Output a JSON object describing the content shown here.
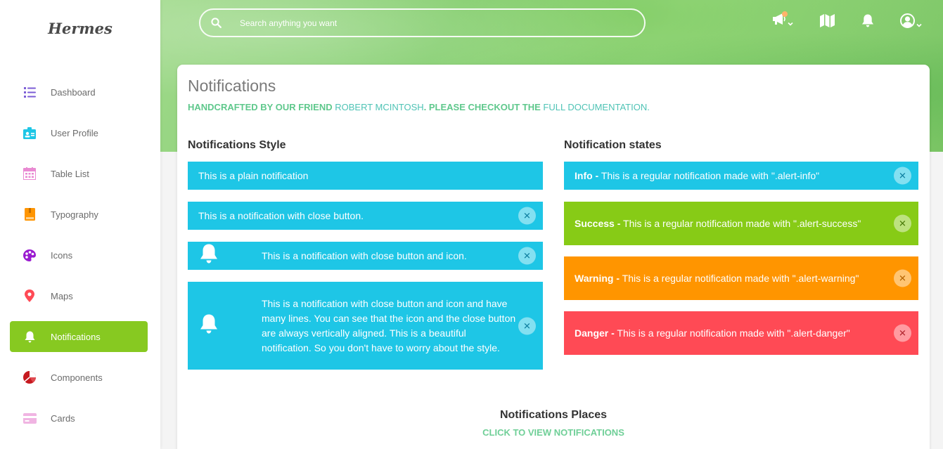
{
  "sidebar": {
    "brand": "Hermes",
    "items": [
      {
        "label": "Dashboard",
        "icon": "list-icon",
        "color": "#7b5cd6"
      },
      {
        "label": "User Profile",
        "icon": "id-card-icon",
        "color": "#1ec6e6"
      },
      {
        "label": "Table List",
        "icon": "calendar-icon",
        "color": "#e98ad2"
      },
      {
        "label": "Typography",
        "icon": "book-icon",
        "color": "#ff9500"
      },
      {
        "label": "Icons",
        "icon": "palette-icon",
        "color": "#9a1ad0"
      },
      {
        "label": "Maps",
        "icon": "pin-icon",
        "color": "#ff4a55"
      },
      {
        "label": "Notifications",
        "icon": "bell-icon",
        "color": "#ffffff"
      },
      {
        "label": "Components",
        "icon": "pie-chart-icon",
        "color": "#c6191f"
      },
      {
        "label": "Cards",
        "icon": "card-icon",
        "color": "#e98ad2"
      }
    ],
    "active_index": 6,
    "active_color": "#87c921"
  },
  "header": {
    "search_placeholder": "Search anything you want",
    "icons": [
      "megaphone-icon",
      "map-icon",
      "bell-icon",
      "user-icon"
    ]
  },
  "page": {
    "title": "Notifications",
    "subtitle_part1": "HANDCRAFTED BY OUR FRIEND",
    "subtitle_link1": "ROBERT MCINTOSH",
    "subtitle_part2": ". PLEASE CHECKOUT THE",
    "subtitle_link2": "FULL DOCUMENTATION."
  },
  "styles_section": {
    "title": "Notifications Style",
    "alerts": [
      {
        "text": "This is a plain notification"
      },
      {
        "text": "This is a notification with close button."
      },
      {
        "text": "This is a notification with close button and icon."
      },
      {
        "text": "This is a notification with close button and icon and have many lines. You can see that the icon and the close button are always vertically aligned. This is a beautiful notification. So you don't have to worry about the style."
      }
    ]
  },
  "states_section": {
    "title": "Notification states",
    "alerts": [
      {
        "label": "Info -",
        "text": " This is a regular notification made with \".alert-info\""
      },
      {
        "label": "Success -",
        "text": " This is a regular notification made with \".alert-success\""
      },
      {
        "label": "Warning -",
        "text": " This is a regular notification made with \".alert-warning\""
      },
      {
        "label": "Danger -",
        "text": " This is a regular notification made with \".alert-danger\""
      }
    ]
  },
  "places": {
    "title": "Notifications Places",
    "link": "CLICK TO VIEW NOTIFICATIONS"
  },
  "close_glyph": "✕",
  "colors": {
    "info": "#1ec6e6",
    "success": "#87cb16",
    "warning": "#ff9500",
    "danger": "#ff4a55",
    "accent": "#6fcf97"
  }
}
